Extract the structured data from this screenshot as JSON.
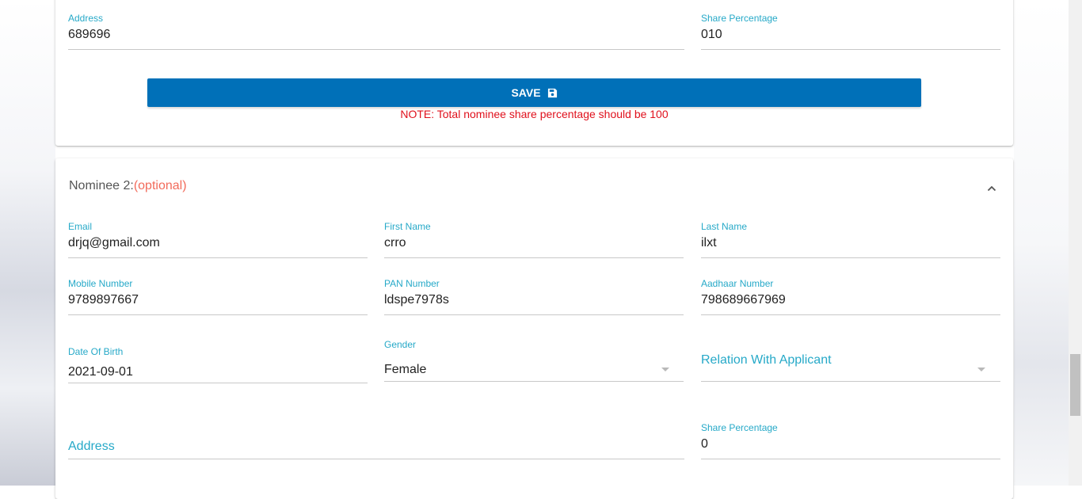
{
  "nominee1": {
    "address": {
      "label": "Address",
      "value": "689696"
    },
    "share_percentage": {
      "label": "Share Percentage",
      "value": "010"
    },
    "save_label": "SAVE",
    "note": "NOTE: Total nominee share percentage should be 100"
  },
  "nominee2": {
    "title": "Nominee 2:",
    "optional": "(optional)",
    "email": {
      "label": "Email",
      "value": "drjq@gmail.com"
    },
    "first_name": {
      "label": "First Name",
      "value": "crro"
    },
    "last_name": {
      "label": "Last Name",
      "value": "ilxt"
    },
    "mobile": {
      "label": "Mobile Number",
      "value": "9789897667"
    },
    "pan": {
      "label": "PAN Number",
      "value": "ldspe7978s"
    },
    "aadhaar": {
      "label": "Aadhaar Number",
      "value": "798689667969"
    },
    "dob": {
      "label": "Date Of Birth",
      "value": "2021-09-01"
    },
    "gender": {
      "label": "Gender",
      "value": "Female"
    },
    "relation": {
      "placeholder": "Relation With Applicant"
    },
    "address": {
      "placeholder": "Address"
    },
    "share_percentage": {
      "label": "Share Percentage",
      "value": "0"
    }
  },
  "colors": {
    "accent": "#26a9c8",
    "button": "#0070b8",
    "note": "#e0101c",
    "optional": "#f26b5b"
  },
  "icons": {
    "save": "floppy-disk-icon",
    "collapse": "chevron-up-icon",
    "dropdown": "caret-down-icon"
  }
}
